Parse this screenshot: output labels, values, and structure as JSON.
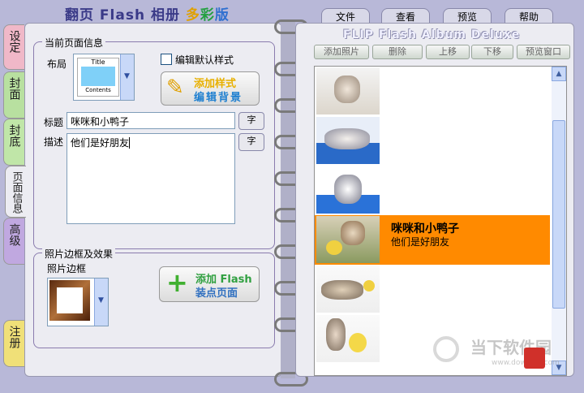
{
  "app": {
    "title_prefix": "翻页 Flash 相册 ",
    "title_c1": "多",
    "title_c2": "彩",
    "title_c3": "版"
  },
  "menu": [
    {
      "label": "文件"
    },
    {
      "label": "查看"
    },
    {
      "label": "预览"
    },
    {
      "label": "帮助"
    }
  ],
  "side_tabs": [
    {
      "label": "设定"
    },
    {
      "label": "封面"
    },
    {
      "label": "封底"
    },
    {
      "label": "页面信息"
    },
    {
      "label": "高级"
    },
    {
      "label": "注册"
    }
  ],
  "page_info": {
    "legend": "当前页面信息",
    "layout_label": "布局",
    "layout_preview_top": "Title",
    "layout_preview_bottom": "Contents",
    "default_style_checkbox": "编辑默认样式",
    "add_style_line1": "添加样式",
    "add_style_line2": "编辑背景",
    "title_label": "标题",
    "title_value": "咪咪和小鸭子",
    "desc_label": "描述",
    "desc_value": "他们是好朋友",
    "font_button": "字"
  },
  "frame_group": {
    "legend": "照片边框及效果",
    "frame_label": "照片边框",
    "add_flash_line1": "添加 Flash",
    "add_flash_line2": "装点页面"
  },
  "right": {
    "title": "FLIP Flash Album Deluxe",
    "toolbar": [
      {
        "label": "添加照片"
      },
      {
        "label": "删除"
      },
      {
        "label": "上移"
      },
      {
        "label": "下移"
      },
      {
        "label": "预览窗口"
      }
    ],
    "rows": [
      {
        "title": "",
        "desc": ""
      },
      {
        "title": "",
        "desc": ""
      },
      {
        "title": "",
        "desc": ""
      },
      {
        "title": "咪咪和小鸭子",
        "desc": "他们是好朋友"
      },
      {
        "title": "",
        "desc": ""
      },
      {
        "title": "",
        "desc": ""
      }
    ]
  },
  "watermark": {
    "brand": "当下软件园",
    "url": "www.downxia.com"
  },
  "colors": {
    "selected_row": "#ff8a00",
    "accent": "#8a7cae"
  }
}
